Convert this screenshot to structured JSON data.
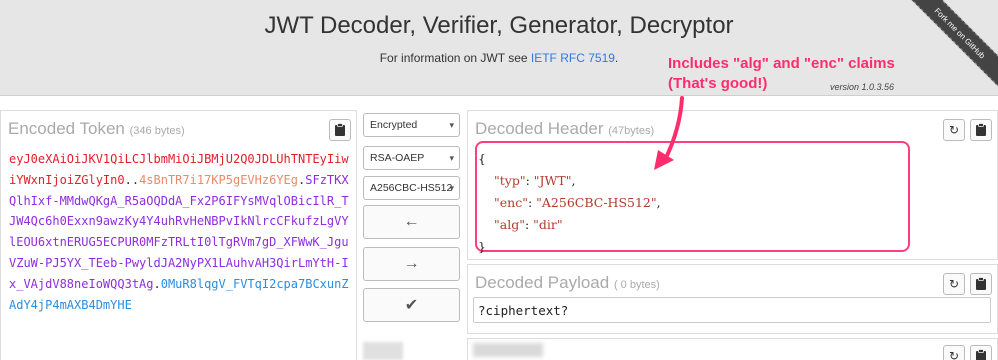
{
  "header": {
    "title": "JWT Decoder, Verifier, Generator, Decryptor",
    "info_prefix": "For information on JWT see ",
    "info_link": "IETF RFC 7519",
    "info_suffix": ".",
    "version": "version 1.0.3.56",
    "ribbon": "Fork me on GitHub"
  },
  "annotation": {
    "line1": "Includes \"alg\" and \"enc\" claims",
    "line2": "(That's good!)",
    "color": "#ff2d6e"
  },
  "encoded": {
    "title": "Encoded Token",
    "size": "(346 bytes)",
    "clipboard_icon": "clipboard-icon",
    "segments": {
      "header": "eyJ0eXAiOiJKV1QiLCJlbmMiOiJBMjU2Q0JDLUhTNTEyIiwiYWxnIjoiZGlyIn0",
      "dot1": ".",
      "key": "",
      "dot2": ".",
      "iv": "4sBnTR7i17KP5gEVHz6YEg",
      "dot3": ".",
      "ciphertext": "SFzTKXQlhIxf-MMdwQKgA_R5aOQDdA_Fx2P6IFYsMVqlOBicIlR_TJW4Qc6h0Exxn9awzKy4Y4uhRvHeNBPvIkNlrcCFkufzLgVYlEOU6xtnERUG5ECPUR0MFzTRLtI0lTgRVm7gD_XFWwK_JguVZuW-PJ5YX_TEeb-PwyldJA2NyPX1LAuhvAH3QirLmYtH-Ix_VAjdV88neIoWQQ3tAg",
      "dot4": ".",
      "tag": "0MuR8lqgV_FVTqI2cpa7BCxunZAdY4jP4mAXB4DmYHE"
    },
    "colors": {
      "header": "#e3202a",
      "key": "#e98a6a",
      "iv": "#8f2de0",
      "ciphertext": "#c638d8",
      "tag": "#2a8ee0"
    }
  },
  "controls": {
    "select_encryption": "Encrypted",
    "select_algorithm": "RSA-OAEP",
    "select_enc": "A256CBC-HS512",
    "decode_arrow": "←",
    "encode_arrow": "→",
    "verify_check": "✔"
  },
  "decoded_header": {
    "title": "Decoded Header",
    "size": "(47bytes)",
    "lines": [
      "{",
      "\"typ\": \"JWT\",",
      "\"enc\": \"A256CBC-HS512\",",
      "\"alg\": \"dir\"",
      "}"
    ],
    "typ_key": "\"typ\"",
    "typ_val": "\"JWT\"",
    "enc_key": "\"enc\"",
    "enc_val": "\"A256CBC-HS512\"",
    "alg_key": "\"alg\"",
    "alg_val": "\"dir\"",
    "highlight_color": "#ff3d7f"
  },
  "decoded_payload": {
    "title": "Decoded Payload",
    "size": "( 0 bytes)",
    "value": "?ciphertext?"
  }
}
